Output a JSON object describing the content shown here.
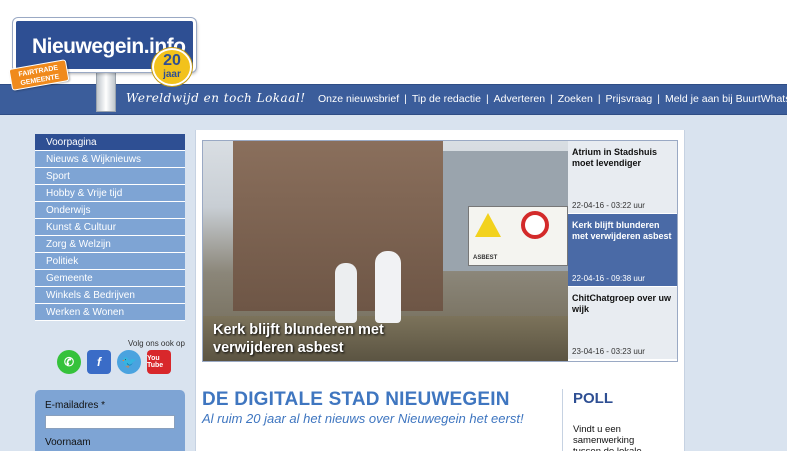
{
  "logo": {
    "name": "Nieuwegein.info",
    "anniversary_number": "20",
    "anniversary_word": "jaar",
    "fairtrade_line1": "FAIRTRADE",
    "fairtrade_line2": "GEMEENTE"
  },
  "header": {
    "slogan": "Wereldwijd en toch Lokaal!",
    "nav": [
      "Onze nieuwsbrief",
      "Tip de redactie",
      "Adverteren",
      "Zoeken",
      "Prijsvraag",
      "Meld je aan bij BuurtWhatsApp"
    ],
    "separator": "|"
  },
  "sidebar": {
    "items": [
      {
        "label": "Voorpagina",
        "active": true
      },
      {
        "label": "Nieuws & Wijknieuws",
        "active": false
      },
      {
        "label": "Sport",
        "active": false
      },
      {
        "label": "Hobby & Vrije tijd",
        "active": false
      },
      {
        "label": "Onderwijs",
        "active": false
      },
      {
        "label": "Kunst & Cultuur",
        "active": false
      },
      {
        "label": "Zorg & Welzijn",
        "active": false
      },
      {
        "label": "Politiek",
        "active": false
      },
      {
        "label": "Gemeente",
        "active": false
      },
      {
        "label": "Winkels & Bedrijven",
        "active": false
      },
      {
        "label": "Werken & Wonen",
        "active": false
      }
    ],
    "follow_label": "Volg ons ook op",
    "social_icons": [
      "whatsapp-icon",
      "facebook-icon",
      "twitter-icon",
      "youtube-icon"
    ],
    "youtube_text": "You Tube"
  },
  "newsletter_form": {
    "email_label": "E-mailadres *",
    "firstname_label": "Voornaam"
  },
  "slider": {
    "caption": "Kerk blijft blunderen met verwijderen asbest",
    "sign_text_1": "ASBEST",
    "items": [
      {
        "title": "Atrium in Stadshuis moet levendiger",
        "date": "22-04-16 - 03:22 uur",
        "active": false
      },
      {
        "title": "Kerk blijft blunderen met verwijderen asbest",
        "date": "22-04-16 - 09:38 uur",
        "active": true
      },
      {
        "title": "ChitChatgroep over uw wijk",
        "date": "23-04-16 - 03:23 uur",
        "active": false
      }
    ]
  },
  "main": {
    "headline": "DE DIGITALE STAD NIEUWEGEIN",
    "subline": "Al ruim 20 jaar al het nieuws over Nieuwegein het eerst!"
  },
  "poll": {
    "title": "POLL",
    "text": "Vindt u een samenwerking tussen de lokale"
  },
  "colors": {
    "header_blue": "#3b5d9b",
    "nav_item": "#7ea4d4",
    "nav_active": "#2e4f93",
    "headline_blue": "#3f76c0",
    "panel_bg": "#d9e3ef"
  }
}
